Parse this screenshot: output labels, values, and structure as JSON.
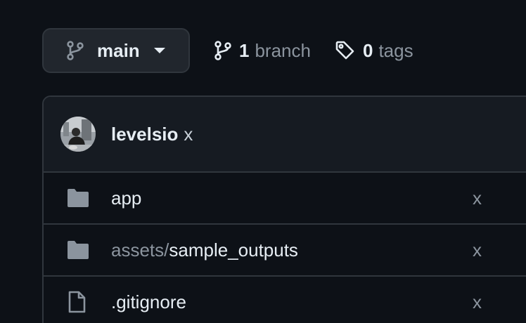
{
  "branch": {
    "current": "main",
    "branch_count": "1",
    "branch_label": "branch",
    "tag_count": "0",
    "tag_label": "tags"
  },
  "commit": {
    "author": "levelsio",
    "message": "x"
  },
  "files": [
    {
      "type": "folder",
      "dir": "",
      "name": "app",
      "message": "x"
    },
    {
      "type": "folder",
      "dir": "assets/",
      "name": "sample_outputs",
      "message": "x"
    },
    {
      "type": "file",
      "dir": "",
      "name": ".gitignore",
      "message": "x"
    }
  ],
  "colors": {
    "background": "#0d1117",
    "border": "#30363d",
    "muted": "#8b949e",
    "text": "#e6edf3"
  }
}
